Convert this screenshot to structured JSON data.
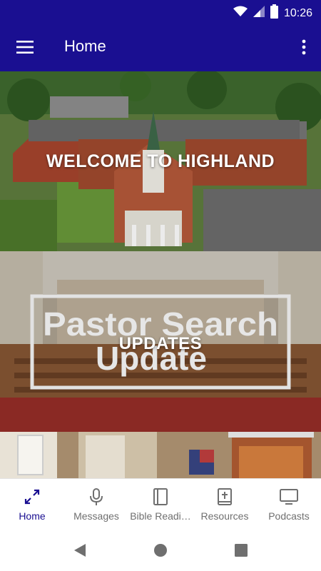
{
  "status_bar": {
    "time": "10:26",
    "icons": [
      "wifi-icon",
      "signal-icon",
      "battery-icon"
    ]
  },
  "app_bar": {
    "title": "Home",
    "menu_icon": "hamburger-menu-icon",
    "overflow_icon": "more-vert-icon"
  },
  "cards": [
    {
      "label": "WELCOME TO HIGHLAND",
      "image": "aerial church photo"
    },
    {
      "label": "UPDATES",
      "image_text": "Pastor Search Update",
      "image": "sanctuary interior"
    },
    {
      "label": "",
      "image": "sanctuary with projection screen"
    }
  ],
  "bottom_nav": {
    "active_index": 0,
    "items": [
      {
        "label": "Home",
        "icon": "home-arrows-icon"
      },
      {
        "label": "Messages",
        "icon": "microphone-icon"
      },
      {
        "label": "Bible Readi…",
        "icon": "book-icon"
      },
      {
        "label": "Resources",
        "icon": "bible-plus-icon"
      },
      {
        "label": "Podcasts",
        "icon": "tv-icon"
      }
    ]
  },
  "system_nav": [
    "back-icon",
    "home-icon",
    "recents-icon"
  ],
  "colors": {
    "primary": "#1a0f91",
    "nav_inactive": "#6f6f6f",
    "background": "#ffffff"
  }
}
